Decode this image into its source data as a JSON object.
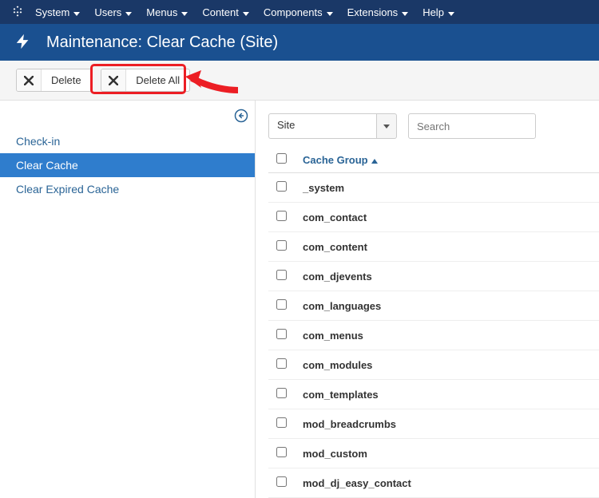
{
  "nav": {
    "items": [
      "System",
      "Users",
      "Menus",
      "Content",
      "Components",
      "Extensions",
      "Help"
    ]
  },
  "header": {
    "title": "Maintenance: Clear Cache (Site)"
  },
  "toolbar": {
    "delete_label": "Delete",
    "delete_all_label": "Delete All"
  },
  "sidebar": {
    "items": [
      {
        "label": "Check-in",
        "active": false
      },
      {
        "label": "Clear Cache",
        "active": true
      },
      {
        "label": "Clear Expired Cache",
        "active": false
      }
    ]
  },
  "filter": {
    "selected": "Site",
    "search_placeholder": "Search"
  },
  "table": {
    "column_header": "Cache Group",
    "rows": [
      "_system",
      "com_contact",
      "com_content",
      "com_djevents",
      "com_languages",
      "com_menus",
      "com_modules",
      "com_templates",
      "mod_breadcrumbs",
      "mod_custom",
      "mod_dj_easy_contact"
    ]
  },
  "colors": {
    "highlight": "#ec1e24"
  }
}
